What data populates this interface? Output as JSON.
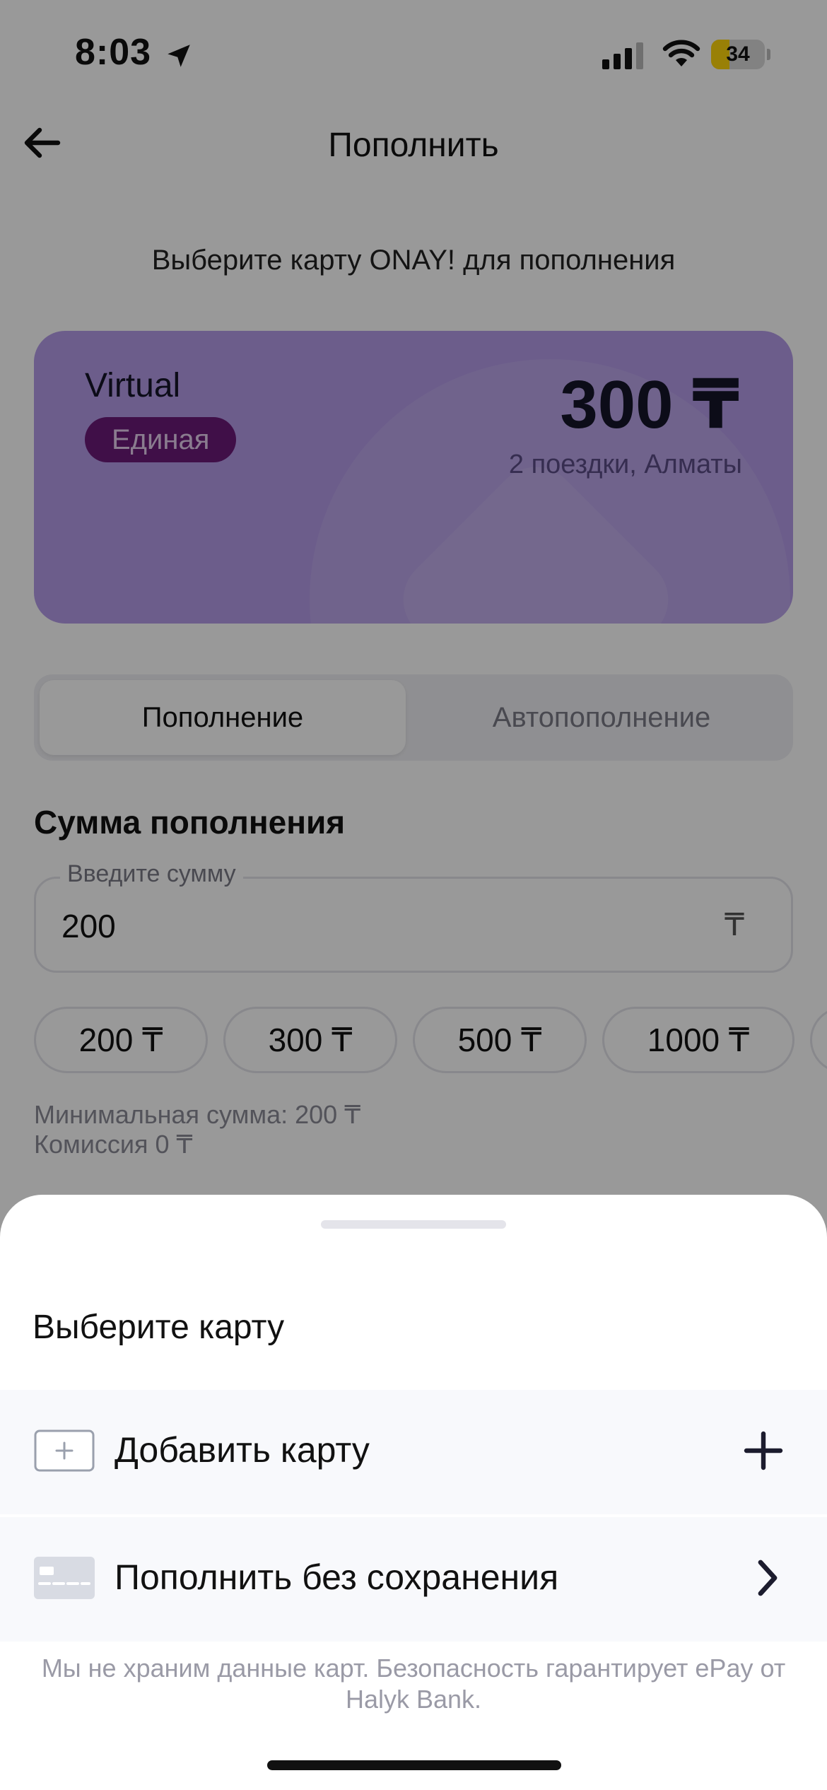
{
  "status_bar": {
    "time": "8:03",
    "battery": "34",
    "battery_fraction": 0.34
  },
  "header": {
    "title": "Пополнить"
  },
  "subtitle": "Выберите карту ONAY! для пополнения",
  "card": {
    "name": "Virtual",
    "badge": "Единая",
    "balance": "300 ₸",
    "trips": "2 поездки, Алматы",
    "color": "#b49be8"
  },
  "tabs": [
    {
      "label": "Пополнение",
      "active": true
    },
    {
      "label": "Автопополнение",
      "active": false
    }
  ],
  "amount": {
    "title": "Сумма пополнения",
    "field_label": "Введите сумму",
    "value": "200",
    "currency": "₸",
    "chips": [
      "200 ₸",
      "300 ₸",
      "500 ₸",
      "1000 ₸"
    ],
    "min_hint": "Минимальная сумма: 200 ₸",
    "commission": "Комиссия 0 ₸"
  },
  "sheet": {
    "title": "Выберите карту",
    "add_card_label": "Добавить карту",
    "pay_without_saving_label": "Пополнить без сохранения",
    "note": "Мы не храним данные карт. Безопасность гарантирует ePay от Halyk Bank."
  },
  "icons": {
    "location": "location-arrow-icon",
    "signal": "cellular-signal-icon",
    "wifi": "wifi-icon",
    "back": "back-arrow-icon",
    "add_card": "card-plus-icon",
    "bank_card": "bank-card-icon",
    "plus": "plus-icon",
    "chevron": "chevron-right-icon"
  },
  "colors": {
    "card": "#b49be8",
    "badge": "#6b1a78",
    "accent_dark": "#1c1c2e",
    "overlay": "rgba(0,0,0,0.40)"
  }
}
